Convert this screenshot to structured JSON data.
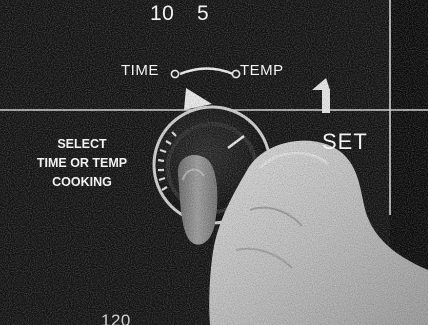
{
  "panel": {
    "scale_top": [
      "10",
      "5"
    ],
    "selector_left": "TIME",
    "selector_right": "TEMP",
    "instruction_lines": [
      "SELECT",
      "TIME OR TEMP",
      "COOKING"
    ],
    "set_label": "SET",
    "scale_bottom": "120"
  }
}
